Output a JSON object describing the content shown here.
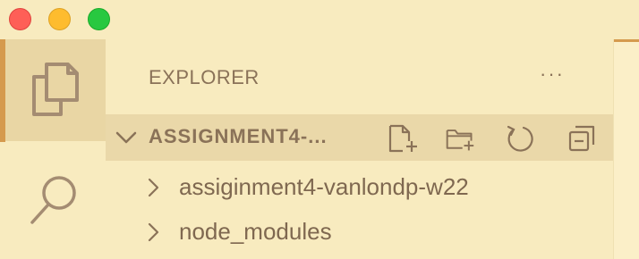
{
  "window": {
    "traffic_lights": [
      "close",
      "minimize",
      "maximize"
    ]
  },
  "activity_bar": {
    "items": [
      {
        "icon": "files-icon",
        "active": true
      },
      {
        "icon": "search-icon",
        "active": false
      }
    ]
  },
  "sidebar": {
    "title": "EXPLORER",
    "more_label": "···",
    "section": {
      "name": "ASSIGNMENT4-...",
      "expanded": true,
      "actions": [
        "new-file-icon",
        "new-folder-icon",
        "refresh-icon",
        "collapse-all-icon"
      ]
    },
    "tree": [
      {
        "label": "assiginment4-vanlondp-w22",
        "type": "folder",
        "expanded": false
      },
      {
        "label": "node_modules",
        "type": "folder",
        "expanded": false
      }
    ]
  },
  "colors": {
    "background": "#f8ebbf",
    "active_item": "#e9d6a4",
    "section_header": "#ead8a9",
    "accent": "#d59a4e",
    "text": "#8a7258"
  }
}
